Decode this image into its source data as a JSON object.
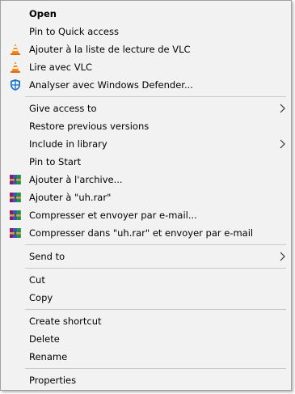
{
  "context_menu": {
    "items": [
      {
        "label": "Open",
        "icon": ""
      },
      {
        "label": "Pin to Quick access",
        "icon": ""
      },
      {
        "label": "Ajouter à la liste de lecture de VLC",
        "icon": "vlc-cone-icon"
      },
      {
        "label": "Lire avec VLC",
        "icon": "vlc-cone-icon"
      },
      {
        "label": "Analyser avec Windows Defender...",
        "icon": "windows-defender-shield-icon"
      },
      {
        "label": "Give access to",
        "icon": "",
        "submenu": true
      },
      {
        "label": "Restore previous versions",
        "icon": ""
      },
      {
        "label": "Include in library",
        "icon": "",
        "submenu": true
      },
      {
        "label": "Pin to Start",
        "icon": ""
      },
      {
        "label": "Ajouter à l'archive...",
        "icon": "winrar-books-icon"
      },
      {
        "label": "Ajouter à \"uh.rar\"",
        "icon": "winrar-books-icon"
      },
      {
        "label": "Compresser et envoyer par e-mail...",
        "icon": "winrar-books-icon"
      },
      {
        "label": "Compresser dans \"uh.rar\" et envoyer par e-mail",
        "icon": "winrar-books-icon"
      },
      {
        "label": "Send to",
        "icon": "",
        "submenu": true
      },
      {
        "label": "Cut",
        "icon": ""
      },
      {
        "label": "Copy",
        "icon": ""
      },
      {
        "label": "Create shortcut",
        "icon": ""
      },
      {
        "label": "Delete",
        "icon": ""
      },
      {
        "label": "Rename",
        "icon": ""
      },
      {
        "label": "Properties",
        "icon": ""
      }
    ]
  },
  "colors": {
    "menu_background": "#f2f2f2",
    "menu_border": "#a0a0a0",
    "separator": "#c9c9c9",
    "text": "#000000",
    "vlc_orange": "#f08c1a",
    "defender_blue": "#1d73c9"
  }
}
